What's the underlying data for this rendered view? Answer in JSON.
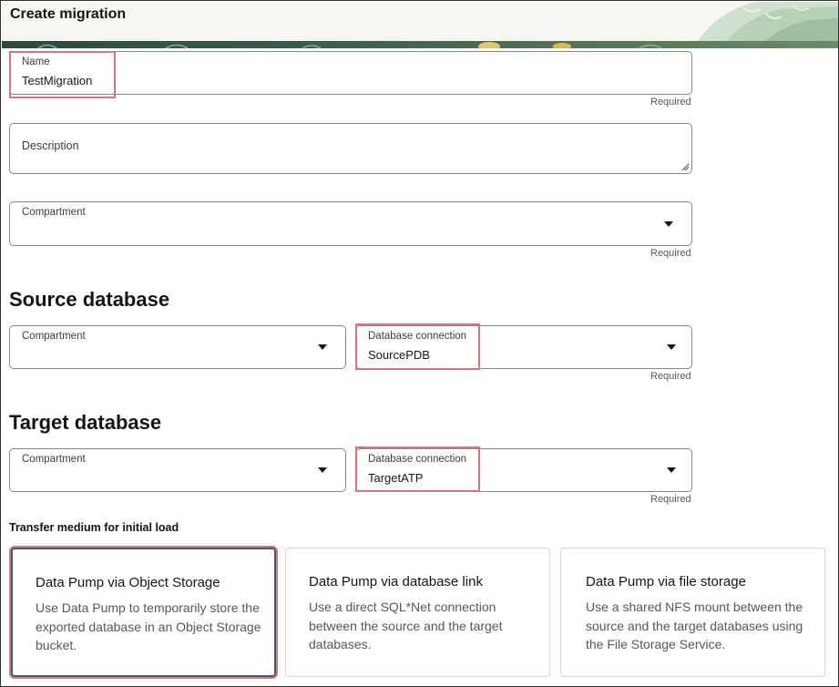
{
  "page": {
    "title": "Create migration"
  },
  "form": {
    "name": {
      "label": "Name",
      "value": "TestMigration",
      "required": "Required"
    },
    "description": {
      "label": "Description"
    },
    "compartment": {
      "label": "Compartment",
      "value": "",
      "required": "Required"
    }
  },
  "source": {
    "heading": "Source database",
    "compartment": {
      "label": "Compartment",
      "value": ""
    },
    "connection": {
      "label": "Database connection",
      "value": "SourcePDB",
      "required": "Required"
    }
  },
  "target": {
    "heading": "Target database",
    "compartment": {
      "label": "Compartment",
      "value": ""
    },
    "connection": {
      "label": "Database connection",
      "value": "TargetATP",
      "required": "Required"
    }
  },
  "transfer": {
    "label": "Transfer medium for initial load",
    "options": [
      {
        "title": "Data Pump via Object Storage",
        "description": "Use Data Pump to temporarily store the exported database in an Object Storage bucket.",
        "selected": true
      },
      {
        "title": "Data Pump via database link",
        "description": "Use a direct SQL*Net connection between the source and the target databases.",
        "selected": false
      },
      {
        "title": "Data Pump via file storage",
        "description": "Use a shared NFS mount between the source and the target databases using the File Storage Service.",
        "selected": false
      }
    ]
  },
  "colors": {
    "highlight": "#d6767a",
    "selected_border": "#3d5e76",
    "header_band": "#2f4a3e"
  }
}
